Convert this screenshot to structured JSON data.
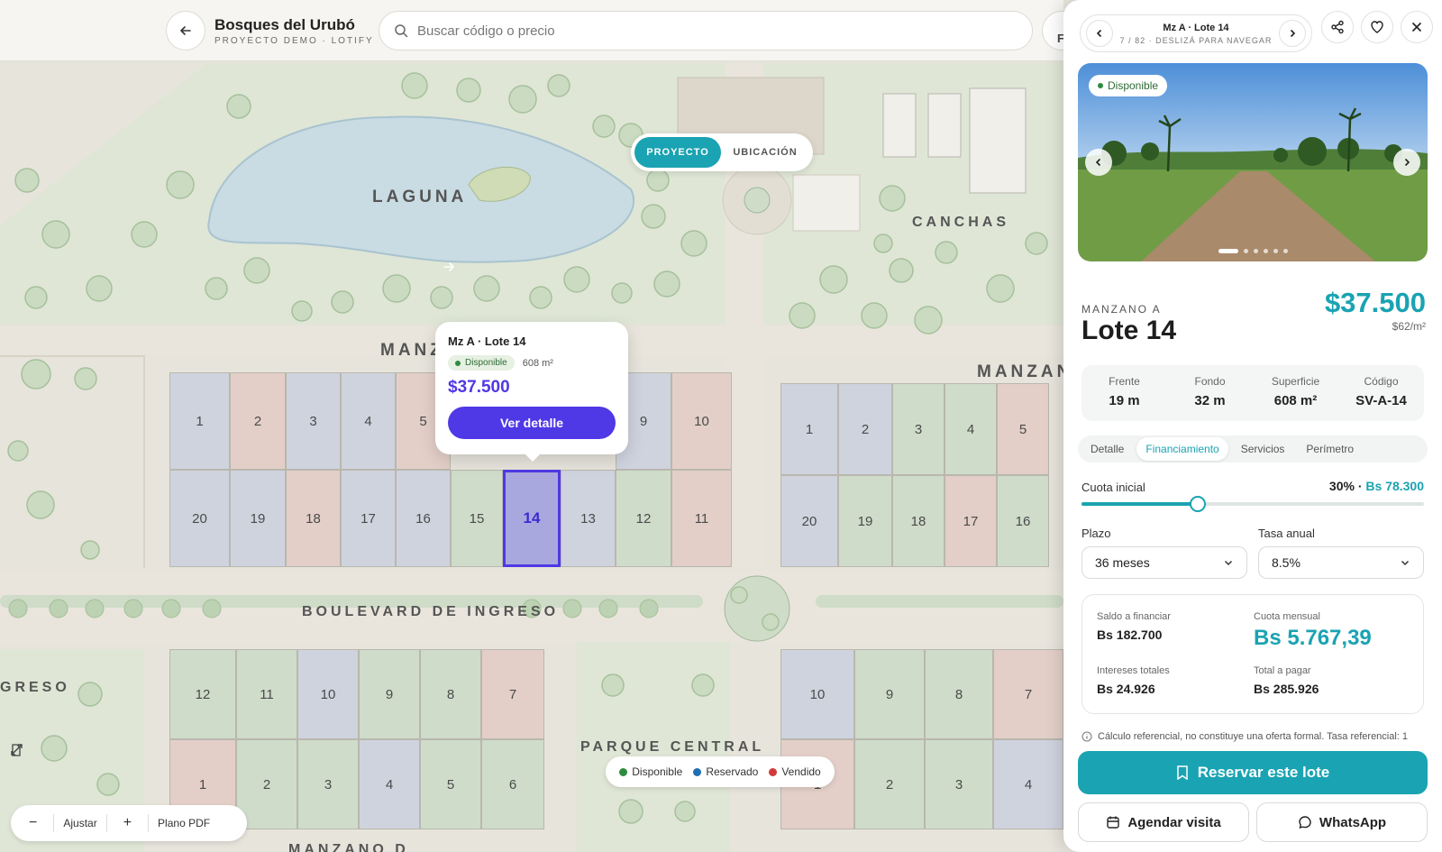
{
  "header": {
    "project_title": "Bosques del Urubó",
    "project_subtitle": "PROYECTO DEMO · LOTIFY",
    "search_placeholder": "Buscar código o precio",
    "filter_label": "F"
  },
  "map": {
    "view_toggle": {
      "project": "PROYECTO",
      "location": "UBICACIÓN"
    },
    "labels": {
      "lagoon": "LAGUNA",
      "courts": "CANCHAS",
      "block_a": "MANZ",
      "block_b": "MANZAN",
      "boulevard": "BOULEVARD DE INGRESO",
      "entry_left": "GRESO",
      "central_park": "PARQUE CENTRAL",
      "block_d": "MANZANO D"
    },
    "block_a_top": [
      {
        "n": "1",
        "s": "r"
      },
      {
        "n": "2",
        "s": "v"
      },
      {
        "n": "3",
        "s": "r"
      },
      {
        "n": "4",
        "s": "r"
      },
      {
        "n": "5",
        "s": "v"
      },
      {
        "n": "9",
        "s": "r"
      },
      {
        "n": "10",
        "s": "v"
      }
    ],
    "block_a_bottom": [
      {
        "n": "20",
        "s": "r"
      },
      {
        "n": "19",
        "s": "r"
      },
      {
        "n": "18",
        "s": "v"
      },
      {
        "n": "17",
        "s": "r"
      },
      {
        "n": "16",
        "s": "r"
      },
      {
        "n": "15",
        "s": "d"
      },
      {
        "n": "14",
        "s": "sel"
      },
      {
        "n": "13",
        "s": "r"
      },
      {
        "n": "12",
        "s": "d"
      },
      {
        "n": "11",
        "s": "v"
      }
    ],
    "block_b_top": [
      {
        "n": "1",
        "s": "r"
      },
      {
        "n": "2",
        "s": "r"
      },
      {
        "n": "3",
        "s": "d"
      },
      {
        "n": "4",
        "s": "d"
      },
      {
        "n": "5",
        "s": "v"
      }
    ],
    "block_b_bottom": [
      {
        "n": "20",
        "s": "r"
      },
      {
        "n": "19",
        "s": "d"
      },
      {
        "n": "18",
        "s": "d"
      },
      {
        "n": "17",
        "s": "v"
      },
      {
        "n": "16",
        "s": "d"
      }
    ],
    "block_c_top": [
      {
        "n": "12",
        "s": "d"
      },
      {
        "n": "11",
        "s": "d"
      },
      {
        "n": "10",
        "s": "r"
      },
      {
        "n": "9",
        "s": "d"
      },
      {
        "n": "8",
        "s": "d"
      },
      {
        "n": "7",
        "s": "v"
      }
    ],
    "block_c_bottom": [
      {
        "n": "1",
        "s": "v"
      },
      {
        "n": "2",
        "s": "d"
      },
      {
        "n": "3",
        "s": "d"
      },
      {
        "n": "4",
        "s": "r"
      },
      {
        "n": "5",
        "s": "d"
      },
      {
        "n": "6",
        "s": "d"
      }
    ],
    "block_e_top": [
      {
        "n": "10",
        "s": "r"
      },
      {
        "n": "9",
        "s": "d"
      },
      {
        "n": "8",
        "s": "d"
      },
      {
        "n": "7",
        "s": "v"
      }
    ],
    "block_e_bottom": [
      {
        "n": "1",
        "s": "v"
      },
      {
        "n": "2",
        "s": "d"
      },
      {
        "n": "3",
        "s": "d"
      },
      {
        "n": "4",
        "s": "r"
      }
    ],
    "popup": {
      "title": "Mz A · Lote 14",
      "status": "Disponible",
      "area": "608 m²",
      "price": "$37.500",
      "cta": "Ver detalle"
    },
    "legend": {
      "available": "Disponible",
      "reserved": "Reservado",
      "sold": "Vendido"
    },
    "toolbar": {
      "zoom_out": "−",
      "fit": "Ajustar",
      "zoom_in": "+",
      "pdf": "Plano PDF"
    }
  },
  "colors": {
    "accent": "#1aa3b2",
    "primary": "#4f38e6",
    "available": "#2e8b3e",
    "reserved": "#1f6fb2",
    "sold": "#d23a3a"
  },
  "panel": {
    "nav_title": "Mz A · Lote 14",
    "nav_sub": "7 / 82 · DESLIZÁ PARA NAVEGAR",
    "photo_badge": "Disponible",
    "block_label": "MANZANO A",
    "lot_title": "Lote 14",
    "price": "$37.500",
    "price_per_m2": "$62/m²",
    "specs": [
      {
        "k": "Frente",
        "v": "19 m"
      },
      {
        "k": "Fondo",
        "v": "32 m"
      },
      {
        "k": "Superficie",
        "v": "608 m²"
      },
      {
        "k": "Código",
        "v": "SV-A-14"
      }
    ],
    "tabs": [
      "Detalle",
      "Financiamiento",
      "Servicios",
      "Perímetro"
    ],
    "active_tab": "Financiamiento",
    "financing": {
      "down_label": "Cuota inicial",
      "down_pct": "30%",
      "down_sep": " · ",
      "down_amount": "Bs 78.300",
      "slider_fraction": 0.34,
      "term_label": "Plazo",
      "term_value": "36 meses",
      "rate_label": "Tasa anual",
      "rate_value": "8.5%",
      "balance_label": "Saldo a financiar",
      "balance_value": "Bs 182.700",
      "monthly_label": "Cuota mensual",
      "monthly_value": "Bs 5.767,39",
      "interest_label": "Intereses totales",
      "interest_value": "Bs 24.926",
      "total_label": "Total a pagar",
      "total_value": "Bs 285.926",
      "note": "Cálculo referencial, no constituye una oferta formal. Tasa referencial: 1"
    },
    "actions": {
      "reserve": "Reservar este lote",
      "schedule": "Agendar visita",
      "whatsapp": "WhatsApp"
    }
  }
}
